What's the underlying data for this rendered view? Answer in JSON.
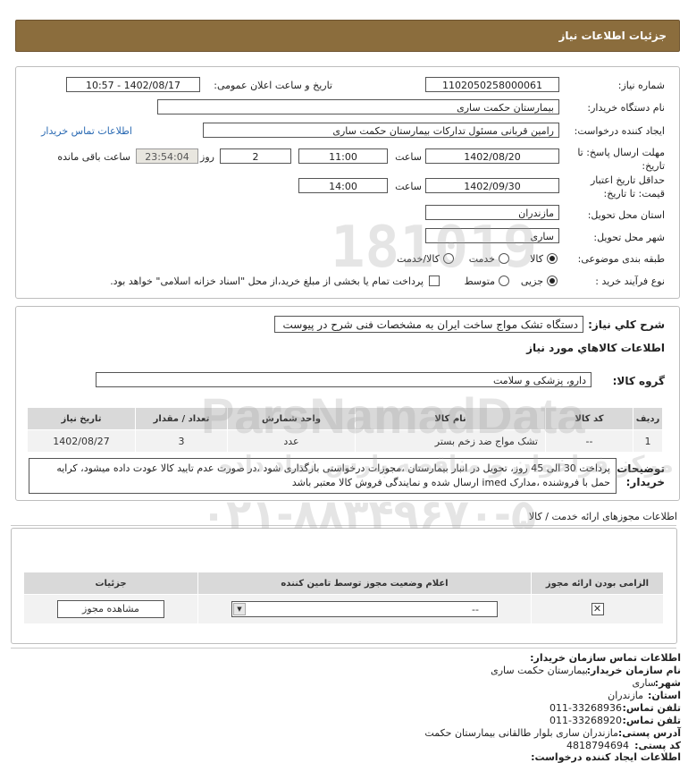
{
  "header": {
    "title": "جزئیات اطلاعات نیاز"
  },
  "form": {
    "need_number_label": "شماره نیاز:",
    "need_number": "1102050258000061",
    "announce_label": "تاریخ و ساعت اعلان عمومی:",
    "announce_value": "1402/08/17 - 10:57",
    "buyer_label": "نام دستگاه خریدار:",
    "buyer_value": "بیمارستان حکمت ساری",
    "creator_label": "ایجاد کننده درخواست:",
    "creator_value": "رامین  قربانی مسئول تدارکات بیمارستان حکمت ساری",
    "contact_link": "اطلاعات تماس خریدار",
    "reply_deadline_label": "مهلت ارسال پاسخ: تا تاریخ:",
    "reply_date": "1402/08/20",
    "time_label": "ساعت",
    "reply_time": "11:00",
    "days_value": "2",
    "days_label": "روز و",
    "remaining_time": "23:54:04",
    "remaining_label": "ساعت باقی مانده",
    "validity_label": "حداقل تاریخ اعتبار قیمت: تا تاریخ:",
    "validity_date": "1402/09/30",
    "validity_time": "14:00",
    "province_label": "استان محل تحویل:",
    "province_value": "مازندران",
    "city_label": "شهر محل تحویل:",
    "city_value": "ساری",
    "category_label": "طبقه بندی موضوعی:",
    "category_options": [
      "کالا",
      "خدمت",
      "کالا/خدمت"
    ],
    "category_selected": "کالا",
    "process_label": "نوع فرآیند خرید :",
    "process_options": [
      "جزیی",
      "متوسط"
    ],
    "process_selected": "جزیی",
    "payment_note": "پرداخت تمام یا بخشی از مبلغ خرید،از محل \"اسناد خزانه اسلامی\" خواهد بود."
  },
  "description": {
    "label": "شرح کلي نياز:",
    "value": "دستگاه تشک مواج ساخت ایران به مشخصات فنی شرح در پیوست"
  },
  "goods": {
    "section_title": "اطلاعات كالاهاي مورد نياز",
    "group_label": "گروه کالا:",
    "group_value": "دارو، پزشکی و سلامت",
    "columns": [
      "ردیف",
      "کد کالا",
      "نام کالا",
      "واحد شمارش",
      "تعداد / مقدار",
      "تاریخ نیاز"
    ],
    "rows": [
      {
        "row": "1",
        "code": "--",
        "name": "تشک مواج ضد زخم بستر",
        "unit": "عدد",
        "qty": "3",
        "date": "1402/08/27"
      }
    ]
  },
  "notes": {
    "label": "توضیحات خریدار:",
    "text": "پرداخت 30 الی 45 روز، تحویل در انبار بیمارستان ،مجوزات درخواستی بارگذاری شود ،در صورت عدم تایید کالا عودت داده میشود، کرایه حمل با فروشنده ،مدارک imed ارسال شده و نمایندگی فروش کالا معتبر باشد"
  },
  "licenses": {
    "title": "اطلاعات مجوزهای ارائه خدمت / کالا",
    "columns": [
      "الزامی بودن ارائه مجوز",
      "اعلام وضعیت مجوز توسط تامین کننده",
      "جزئیات"
    ],
    "select_value": "--",
    "view_button": "مشاهده مجوز"
  },
  "contact": {
    "title": "اطلاعات تماس سازمان خریدار:",
    "org_label": "نام سازمان خریدار:",
    "org_value": "بیمارستان حکمت ساری",
    "city_label": "شهر:",
    "city_value": "ساری",
    "province_label": "استان:",
    "province_value": "مازندران",
    "phone_label": "تلفن تماس:",
    "phone_value": "011-33268936",
    "fax_label": "تلفن تماس:",
    "fax_value": "011-33268920",
    "address_label": "آدرس پستی:",
    "address_value": "مازندران ساری بلوار طالقانی بیمارستان حکمت",
    "postal_label": "کد پستی:",
    "postal_value": "4818794694",
    "creator_label": "اطلاعات ایجاد کننده درخواست:"
  },
  "watermark": {
    "line1": "ParsNamadData",
    "line2": "مرکز فراخوان و مناقصه پارس نماد داده",
    "line3": "۰۲۱-۸۸۳۴۹۶۷۰-۵",
    "digits": "181019"
  }
}
